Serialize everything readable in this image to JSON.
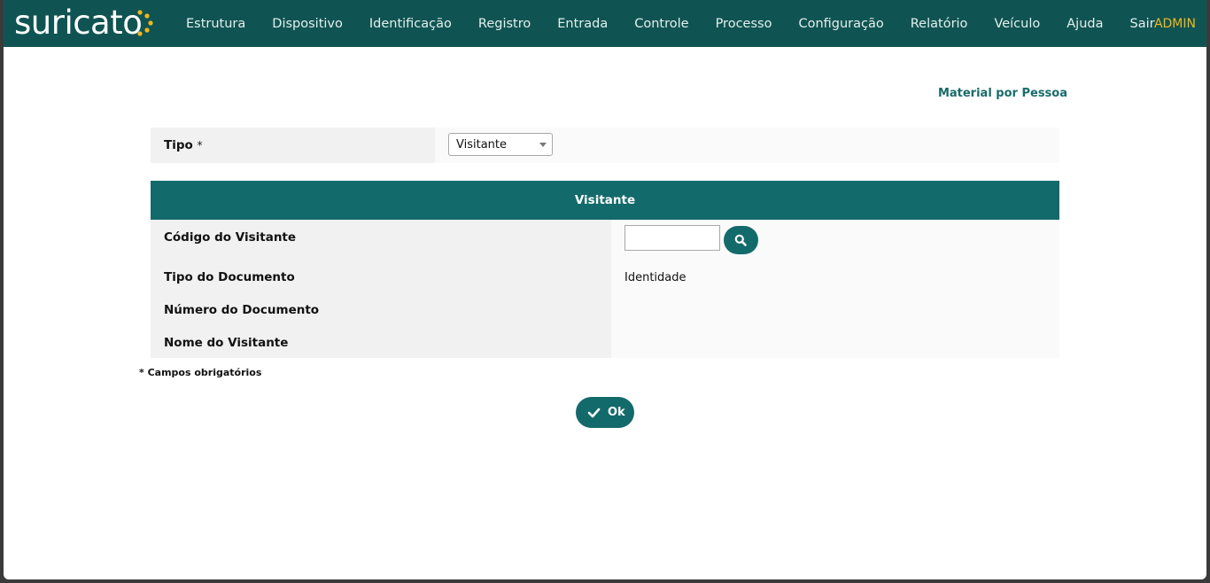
{
  "app": {
    "logo": "suricato",
    "user": "ADMIN",
    "accent_color": "#136a6b",
    "topbar_color": "#0f5452",
    "user_color": "#f2b61e"
  },
  "nav": {
    "items": [
      "Estrutura",
      "Dispositivo",
      "Identificação",
      "Registro",
      "Entrada",
      "Controle",
      "Processo",
      "Configuração",
      "Relatório",
      "Veículo",
      "Ajuda",
      "Sair"
    ]
  },
  "page": {
    "title": "Material por Pessoa"
  },
  "form": {
    "tipo_label": "Tipo",
    "required_mark": "*",
    "tipo_selected": "Visitante",
    "section_title": "Visitante",
    "codigo_label": "Código do Visitante",
    "codigo_value": "",
    "tipo_documento_label": "Tipo do Documento",
    "tipo_documento_value": "Identidade",
    "numero_documento_label": "Número do Documento",
    "numero_documento_value": "",
    "nome_label": "Nome do Visitante",
    "nome_value": "",
    "required_note": "* Campos obrigatórios",
    "ok_label": "Ok",
    "search_icon": "search-icon",
    "ok_icon": "check-icon"
  }
}
